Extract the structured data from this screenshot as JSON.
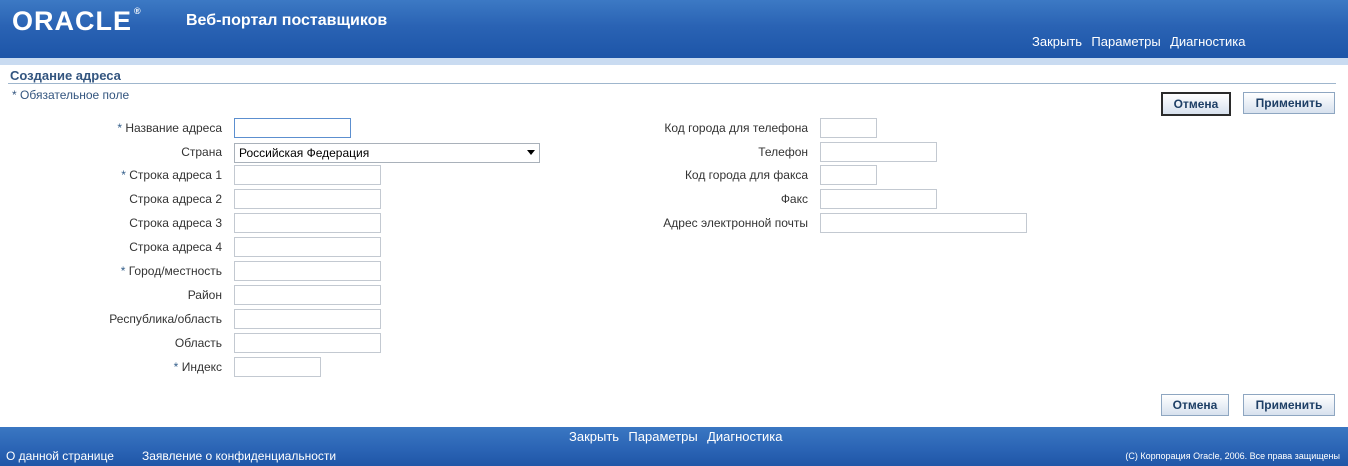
{
  "header": {
    "logo": "ORACLE",
    "logo_reg": "®",
    "portal_title": "Веб-портал поставщиков",
    "links": [
      "Закрыть",
      "Параметры",
      "Диагностика"
    ]
  },
  "page": {
    "title": "Создание адреса",
    "required_note": "* Обязательное поле",
    "required_mark": "*"
  },
  "buttons": {
    "cancel": "Отмена",
    "apply": "Применить"
  },
  "form_left": [
    {
      "label": "Название адреса",
      "required": true,
      "value": ""
    },
    {
      "label": "Страна",
      "required": false,
      "value": "Российская Федерация",
      "type": "select"
    },
    {
      "label": "Строка адреса 1",
      "required": true,
      "value": ""
    },
    {
      "label": "Строка адреса 2",
      "required": false,
      "value": ""
    },
    {
      "label": "Строка адреса 3",
      "required": false,
      "value": ""
    },
    {
      "label": "Строка адреса 4",
      "required": false,
      "value": ""
    },
    {
      "label": "Город/местность",
      "required": true,
      "value": ""
    },
    {
      "label": "Район",
      "required": false,
      "value": ""
    },
    {
      "label": "Республика/область",
      "required": false,
      "value": ""
    },
    {
      "label": "Область",
      "required": false,
      "value": ""
    },
    {
      "label": "Индекс",
      "required": true,
      "value": ""
    }
  ],
  "form_right": [
    {
      "label": "Код города для телефона",
      "value": ""
    },
    {
      "label": "Телефон",
      "value": ""
    },
    {
      "label": "Код города для факса",
      "value": ""
    },
    {
      "label": "Факс",
      "value": ""
    },
    {
      "label": "Адрес электронной почты",
      "value": ""
    }
  ],
  "footer": {
    "links": [
      "Закрыть",
      "Параметры",
      "Диагностика"
    ],
    "about": "О данной странице",
    "privacy": "Заявление о конфиденциальности",
    "copyright": "(C) Корпорация Oracle, 2006. Все права защищены"
  }
}
